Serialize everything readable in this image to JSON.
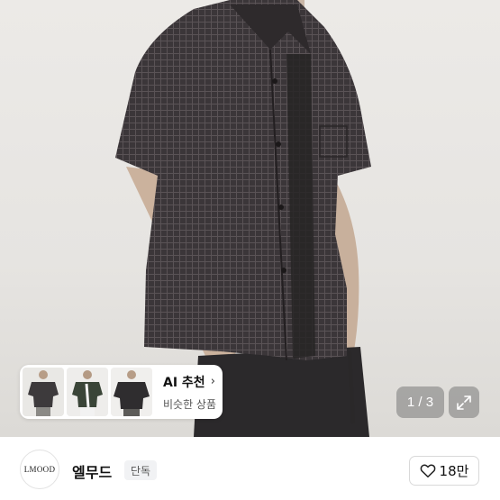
{
  "gallery": {
    "page_indicator": "1 / 3",
    "expand_icon": "expand-arrows-icon"
  },
  "ai_recommend": {
    "title": "AI 추천",
    "chevron": "›",
    "subtitle": "비슷한 상품",
    "thumbnails": [
      "shirt-thumb-1",
      "shirt-thumb-2",
      "shirt-thumb-3"
    ]
  },
  "brand_bar": {
    "logo_text": "LMOOD",
    "brand_name": "엘무드",
    "badge": "단독",
    "like_count": "18만",
    "like_icon": "heart-outline-icon"
  },
  "colors": {
    "shirt": "#3a3538",
    "background": "#e8e6e3",
    "pill_bg": "#787878"
  }
}
